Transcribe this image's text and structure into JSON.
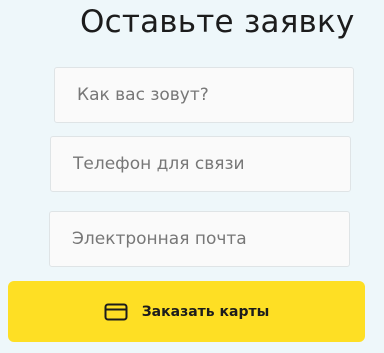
{
  "form": {
    "title": "Оставьте заявку",
    "fields": {
      "name": {
        "placeholder": "Как вас зовут?",
        "value": ""
      },
      "phone": {
        "placeholder": "Телефон для связи",
        "value": ""
      },
      "email": {
        "placeholder": "Электронная почта",
        "value": ""
      }
    },
    "submit": {
      "label": "Заказать карты",
      "icon": "credit-card-icon"
    }
  },
  "colors": {
    "background": "#eef7fa",
    "button": "#fedf24",
    "field": "#fafafa"
  }
}
